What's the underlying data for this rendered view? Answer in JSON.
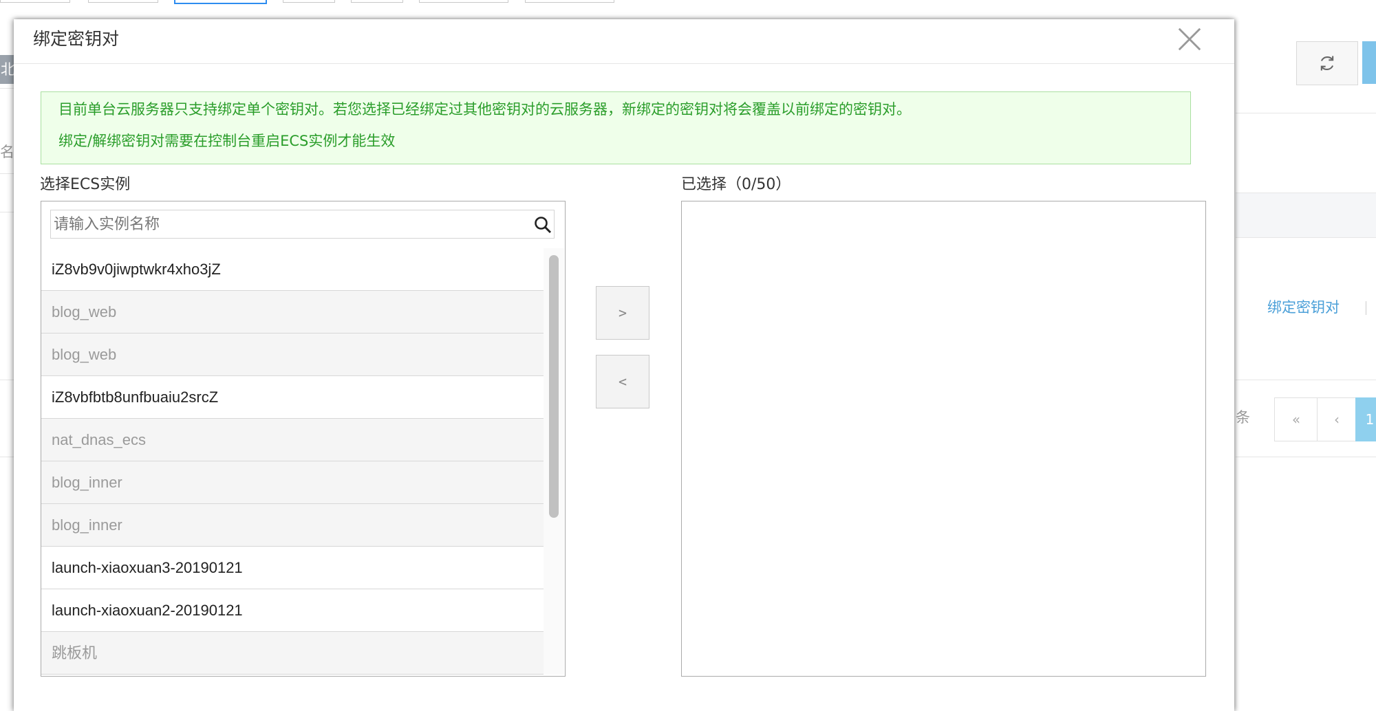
{
  "background": {
    "left_edge_label": "北",
    "left_edge_placeholder": "名称",
    "row_action_link": "绑定密钥对",
    "pagination_suffix": "条",
    "pager_first": "«",
    "pager_prev": "‹",
    "pager_current": "1"
  },
  "dialog": {
    "title": "绑定密钥对",
    "notice": {
      "line1": "目前单台云服务器只支持绑定单个密钥对。若您选择已经绑定过其他密钥对的云服务器，新绑定的密钥对将会覆盖以前绑定的密钥对。",
      "line2": "绑定/解绑密钥对需要在控制台重启ECS实例才能生效"
    },
    "left": {
      "label": "选择ECS实例",
      "search_placeholder": "请输入实例名称",
      "search_value": "",
      "items": [
        {
          "name": "iZ8vb9v0jiwptwkr4xho3jZ",
          "disabled": false
        },
        {
          "name": "blog_web",
          "disabled": true
        },
        {
          "name": "blog_web",
          "disabled": true
        },
        {
          "name": "iZ8vbfbtb8unfbuaiu2srcZ",
          "disabled": false
        },
        {
          "name": "nat_dnas_ecs",
          "disabled": true
        },
        {
          "name": "blog_inner",
          "disabled": true
        },
        {
          "name": "blog_inner",
          "disabled": true
        },
        {
          "name": "launch-xiaoxuan3-20190121",
          "disabled": false
        },
        {
          "name": "launch-xiaoxuan2-20190121",
          "disabled": false
        },
        {
          "name": "跳板机",
          "disabled": true
        }
      ]
    },
    "transfer": {
      "add_label": ">",
      "remove_label": "<"
    },
    "right": {
      "label": "已选择（0/50）"
    }
  },
  "colors": {
    "notice_text": "#2a9d2a",
    "notice_bg": "#efffea",
    "link": "#4a9fd8"
  },
  "icons": {
    "close": "close-icon",
    "search": "search-icon",
    "refresh": "refresh-icon"
  }
}
